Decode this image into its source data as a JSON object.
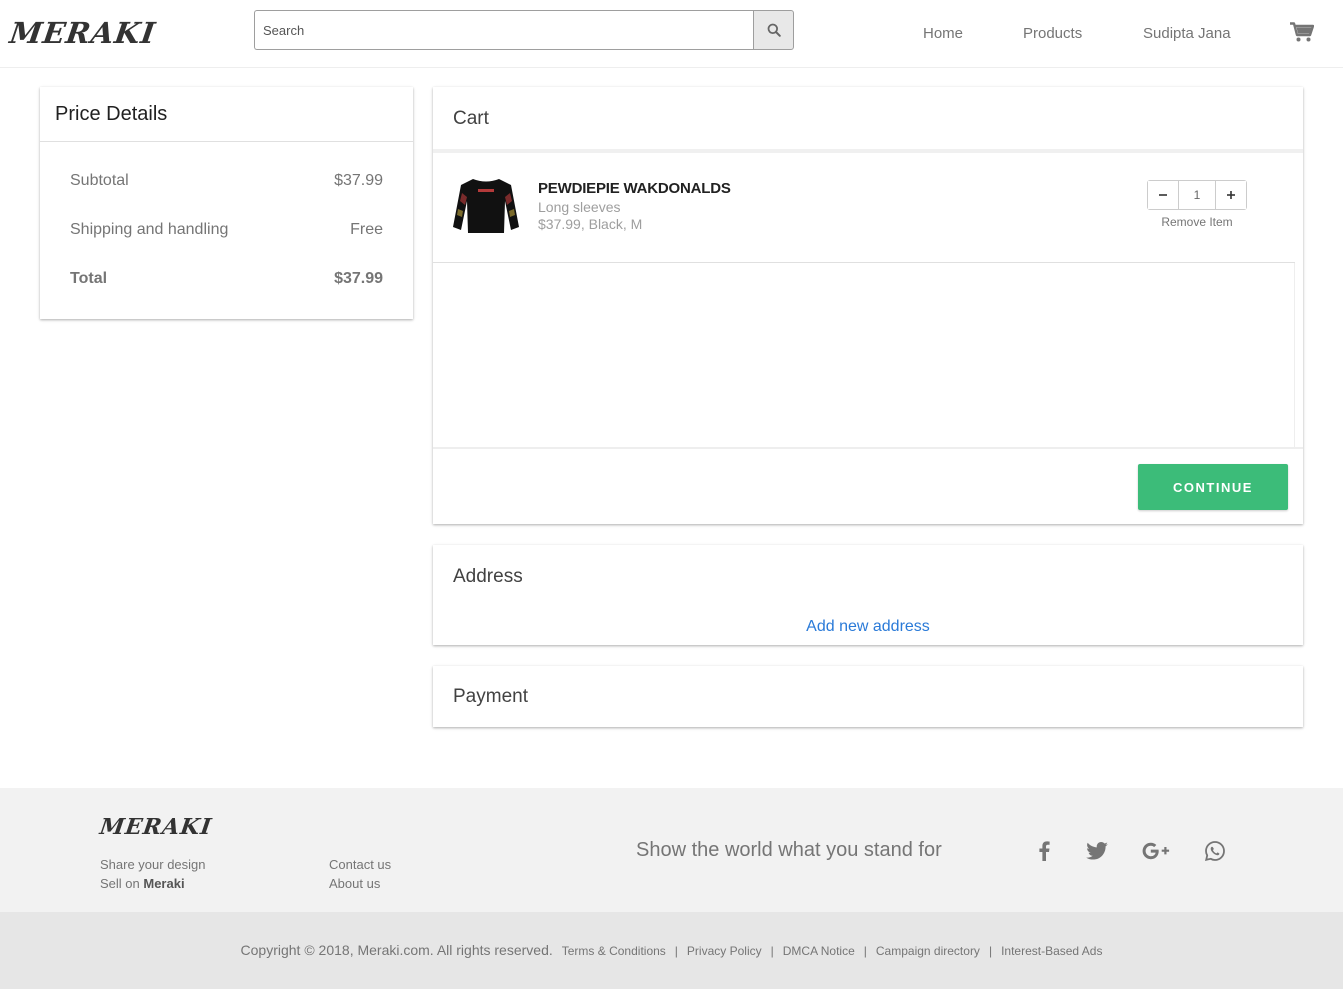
{
  "header": {
    "logo": "MERAKI",
    "search": {
      "placeholder": "Search",
      "value": ""
    },
    "nav": [
      "Home",
      "Products",
      "Sudipta Jana"
    ]
  },
  "price_details": {
    "title": "Price Details",
    "subtotal_label": "Subtotal",
    "subtotal_value": "$37.99",
    "shipping_label": "Shipping and handling",
    "shipping_value": "Free",
    "total_label": "Total",
    "total_value": "$37.99"
  },
  "cart": {
    "title": "Cart",
    "item": {
      "name": "PEWDIEPIE WAKDONALDS",
      "variant": "Long sleeves",
      "price_line": "$37.99, Black, M",
      "quantity": "1",
      "remove_label": "Remove Item"
    },
    "continue_label": "CONTINUE"
  },
  "address": {
    "title": "Address",
    "add_label": "Add new address"
  },
  "payment": {
    "title": "Payment"
  },
  "footer": {
    "logo": "MERAKI",
    "share": "Share your design",
    "sell_prefix": "Sell on ",
    "sell_brand": "Meraki",
    "contact": "Contact us",
    "about": "About us",
    "tagline": "Show the world what you stand for",
    "social": [
      "facebook-icon",
      "twitter-icon",
      "google-plus-icon",
      "whatsapp-icon"
    ],
    "copyright": "Copyright © 2018, Meraki.com. All rights reserved.",
    "links": [
      "Terms & Conditions",
      "Privacy Policy",
      "DMCA Notice",
      "Campaign directory",
      "Interest-Based Ads"
    ]
  },
  "colors": {
    "accent_green": "#3cbc79",
    "link_blue": "#2a7ad8"
  }
}
